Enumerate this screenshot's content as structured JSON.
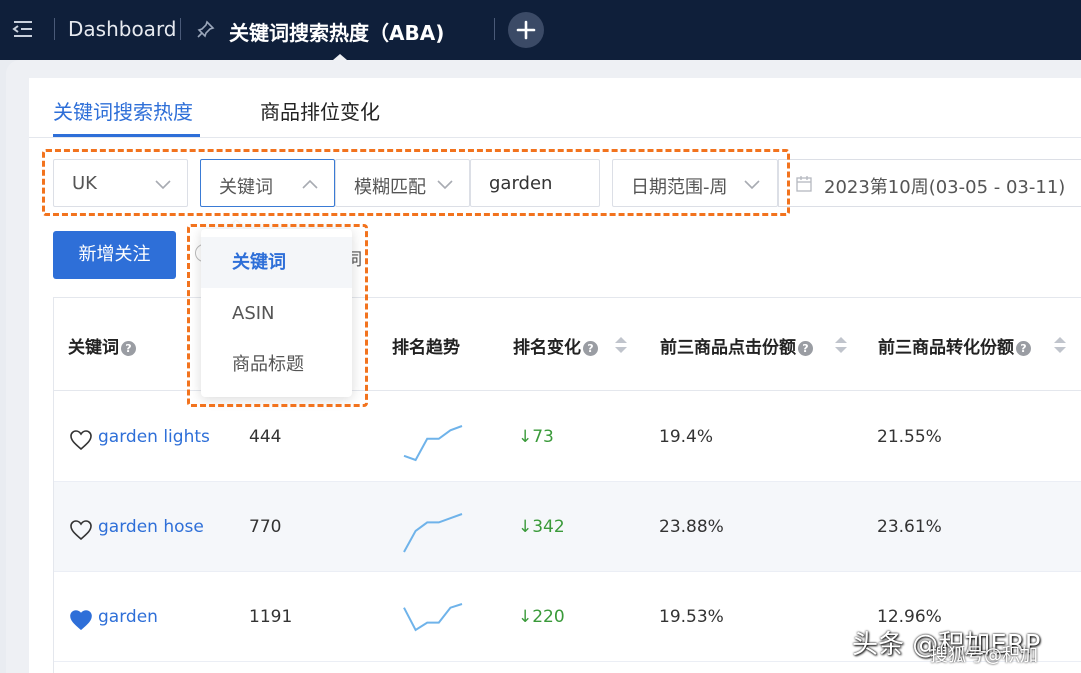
{
  "topbar": {
    "dashboard_label": "Dashboard",
    "page_title": "关键词搜索热度（ABA)"
  },
  "tabs": [
    {
      "label": "关键词搜索热度",
      "active": true
    },
    {
      "label": "商品排位变化",
      "active": false
    }
  ],
  "filters": {
    "marketplace": "UK",
    "search_type": "关键词",
    "match_mode": "模糊匹配",
    "keyword_value": "garden",
    "date_range_type": "日期范围-周",
    "date_value": "2023第10周(03-05 - 03-11)"
  },
  "dropdown": {
    "options": [
      {
        "label": "关键词",
        "selected": true
      },
      {
        "label": "ASIN",
        "selected": false
      },
      {
        "label": "商品标题",
        "selected": false
      }
    ]
  },
  "actions": {
    "add_follow_label": "新增关注",
    "partial_text": "词"
  },
  "table": {
    "columns": [
      {
        "label": "关键词",
        "help": true
      },
      {
        "label": "排名趋势",
        "help": false
      },
      {
        "label": "排名变化",
        "help": true
      },
      {
        "label": "前三商品点击份额",
        "help": true
      },
      {
        "label": "前三商品转化份额",
        "help": true
      }
    ],
    "rows": [
      {
        "favorite": false,
        "keyword": "garden lights",
        "rank": "444",
        "change": "↓73",
        "click_share": "19.4%",
        "conv_share": "21.55%",
        "trend": [
          2,
          1,
          6,
          6,
          8,
          9
        ]
      },
      {
        "favorite": false,
        "keyword": "garden hose",
        "rank": "770",
        "change": "↓342",
        "click_share": "23.88%",
        "conv_share": "23.61%",
        "trend": [
          1,
          6,
          8,
          8,
          9,
          10
        ]
      },
      {
        "favorite": true,
        "keyword": "garden",
        "rank": "1191",
        "change": "↓220",
        "click_share": "19.53%",
        "conv_share": "12.96%",
        "trend": [
          9,
          3,
          5,
          5,
          9,
          10
        ]
      }
    ]
  },
  "watermark": {
    "line1": "头条 @积加ERP",
    "line2": "搜狐号@积加"
  },
  "colors": {
    "accent": "#2e6fd8",
    "topbar": "#0f1f3a",
    "highlight": "#f2731e",
    "decrease": "#3a9a3a",
    "sparkline": "#6fb3ea"
  }
}
